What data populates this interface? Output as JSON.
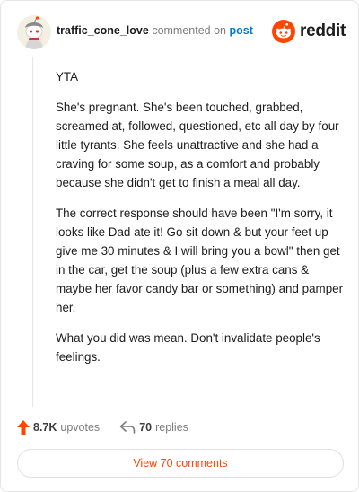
{
  "header": {
    "username": "traffic_cone_love",
    "action_text": "commented on",
    "post_link": "post",
    "brand_wordmark": "reddit",
    "brand_color": "#ff4500",
    "avatar_icon": "snoo-avatar-icon"
  },
  "comment": {
    "paragraphs": [
      "YTA",
      "She's pregnant. She's been touched, grabbed, screamed at, followed, questioned, etc all day by four little tyrants. She feels unattractive and she had a craving for some soup, as a comfort and probably because she didn't get to finish a meal all day.",
      "The correct response should have been \"I'm sorry, it looks like Dad ate it! Go sit down & but your feet up give me 30 minutes & I will bring you a bowl\" then get in the car, get the soup (plus a few extra cans & maybe her favor candy bar or something) and pamper her.",
      "What you did was mean. Don't invalidate people's feelings."
    ]
  },
  "actions": {
    "upvote_count": "8.7K",
    "upvote_label": "upvotes",
    "reply_count": "70",
    "reply_label": "replies",
    "upvote_color": "#ff4500"
  },
  "view_button": {
    "label": "View 70 comments"
  }
}
